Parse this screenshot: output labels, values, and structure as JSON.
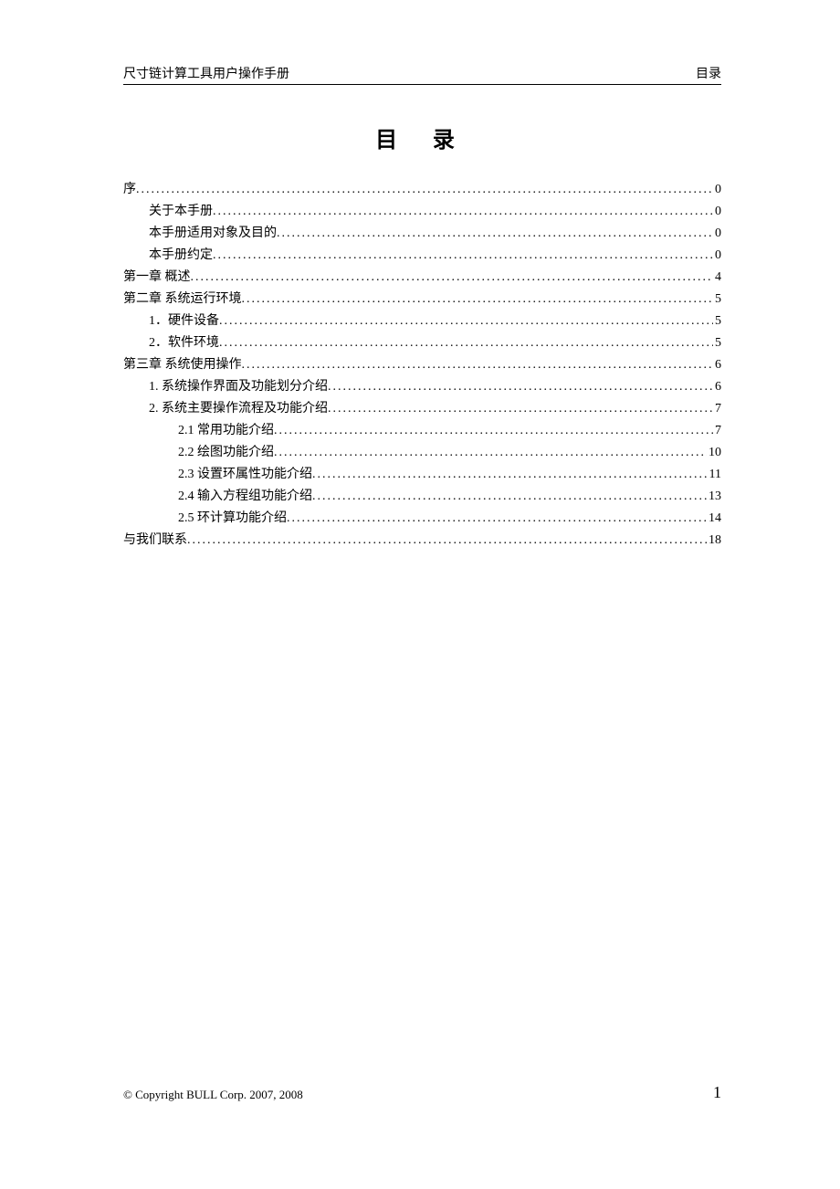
{
  "header": {
    "left": "尺寸链计算工具用户操作手册",
    "right": "目录"
  },
  "title": "目 录",
  "toc": [
    {
      "label": "序",
      "page": "0",
      "indent": 0
    },
    {
      "label": "关于本手册",
      "page": "0",
      "indent": 1
    },
    {
      "label": "本手册适用对象及目的",
      "page": "0",
      "indent": 1
    },
    {
      "label": "本手册约定",
      "page": "0",
      "indent": 1
    },
    {
      "label": "第一章  概述",
      "page": "4",
      "indent": 0
    },
    {
      "label": "第二章  系统运行环境",
      "page": "5",
      "indent": 0
    },
    {
      "label": "1．硬件设备",
      "page": "5",
      "indent": 1
    },
    {
      "label": "2．软件环境",
      "page": "5",
      "indent": 1
    },
    {
      "label": "第三章  系统使用操作",
      "page": "6",
      "indent": 0
    },
    {
      "label": "1.  系统操作界面及功能划分介绍",
      "page": "6",
      "indent": 1
    },
    {
      "label": "2.  系统主要操作流程及功能介绍",
      "page": "7",
      "indent": 1
    },
    {
      "label": "2.1 常用功能介绍",
      "page": "7",
      "indent": 2
    },
    {
      "label": "2.2 绘图功能介绍",
      "page": "10",
      "indent": 2
    },
    {
      "label": "2.3 设置环属性功能介绍",
      "page": "11",
      "indent": 2
    },
    {
      "label": "2.4 输入方程组功能介绍",
      "page": "13",
      "indent": 2
    },
    {
      "label": "2.5 环计算功能介绍",
      "page": "14",
      "indent": 2
    },
    {
      "label": "与我们联系",
      "page": "18",
      "indent": 0
    }
  ],
  "footer": {
    "copyright": "© Copyright BULL Corp. 2007, 2008",
    "pageNumber": "1"
  }
}
